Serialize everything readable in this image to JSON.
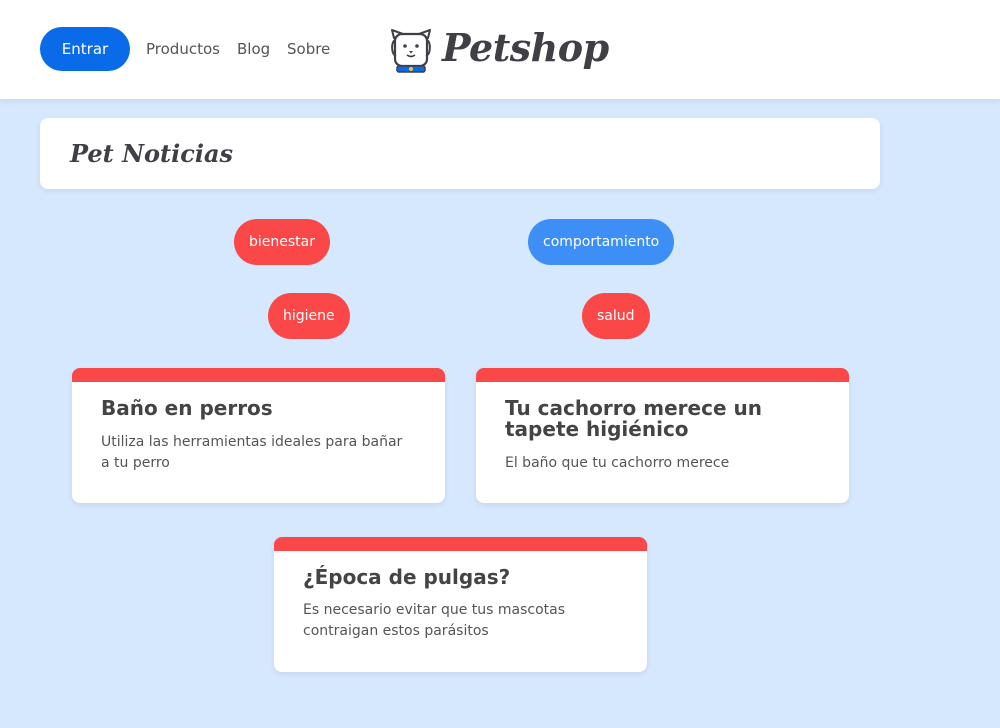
{
  "header": {
    "login_label": "Entrar",
    "nav": [
      {
        "label": "Productos"
      },
      {
        "label": "Blog"
      },
      {
        "label": "Sobre"
      }
    ],
    "brand": "Petshop"
  },
  "section": {
    "title": "Pet Noticias"
  },
  "categories": [
    {
      "label": "bienestar",
      "color": "#fa4747"
    },
    {
      "label": "comportamiento",
      "color": "#3d8ef5"
    },
    {
      "label": "higiene",
      "color": "#fa4747"
    },
    {
      "label": "salud",
      "color": "#fa4747"
    }
  ],
  "posts": [
    {
      "title": "Baño en perros",
      "description": "Utiliza las herramientas ideales para bañar a tu perro"
    },
    {
      "title": "Tu cachorro merece un tapete higiénico",
      "description": "El baño que tu cachorro merece"
    },
    {
      "title": "¿Época de pulgas?",
      "description": "Es necesario evitar que tus mascotas contraigan estos parásitos"
    }
  ],
  "colors": {
    "primary": "#0a6be8",
    "background": "#d6e8fd",
    "accent_red": "#fa4747",
    "accent_blue": "#3d8ef5"
  }
}
